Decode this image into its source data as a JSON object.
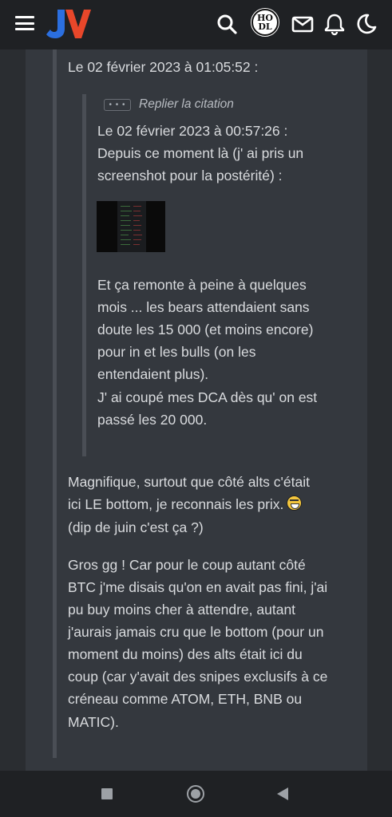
{
  "header": {
    "logo_text": "JV",
    "avatar_text": "HODL",
    "icons": [
      "menu-icon",
      "search-icon",
      "mail-icon",
      "bell-icon",
      "moon-icon"
    ]
  },
  "post": {
    "quote_header": "Le 02 février 2023 à 01:05:52 :",
    "reply_button": "• • •",
    "reply_label": "Replier la citation",
    "inner_quote": {
      "header": "Le 02 février 2023 à 00:57:26 :",
      "lines_1": [
        "Depuis ce moment là (j' ai pris un",
        "screenshot pour la postérité) :"
      ],
      "lines_2": [
        "Et ça remonte à peine à quelques",
        "mois ... les bears attendaient sans",
        "doute les 15 000 (et moins encore)",
        "pour in et les bulls (on les",
        "entendaient plus).",
        "J' ai coupé mes DCA dès qu' on est",
        "passé les 20 000."
      ]
    },
    "paragraph_1": [
      "Magnifique, surtout que côté alts c'était",
      "ici LE bottom, je reconnais les prix.",
      "(dip de juin c'est ça ?)"
    ],
    "paragraph_2": [
      "Gros gg ! Car pour le coup autant côté",
      "BTC j'me disais qu'on en avait pas fini, j'ai",
      "pu buy moins cher à attendre, autant",
      "j'aurais jamais cru que le bottom (pour un",
      "moment du moins) des alts était ici du",
      "coup (car y'avait des snipes exclusifs à ce",
      "créneau comme ATOM, ETH, BNB ou",
      "MATIC)."
    ]
  },
  "colors": {
    "logo_j": "#2b6fe0",
    "logo_v": "#e8472a",
    "background": "#2a2d31",
    "post_background": "#34383e"
  }
}
